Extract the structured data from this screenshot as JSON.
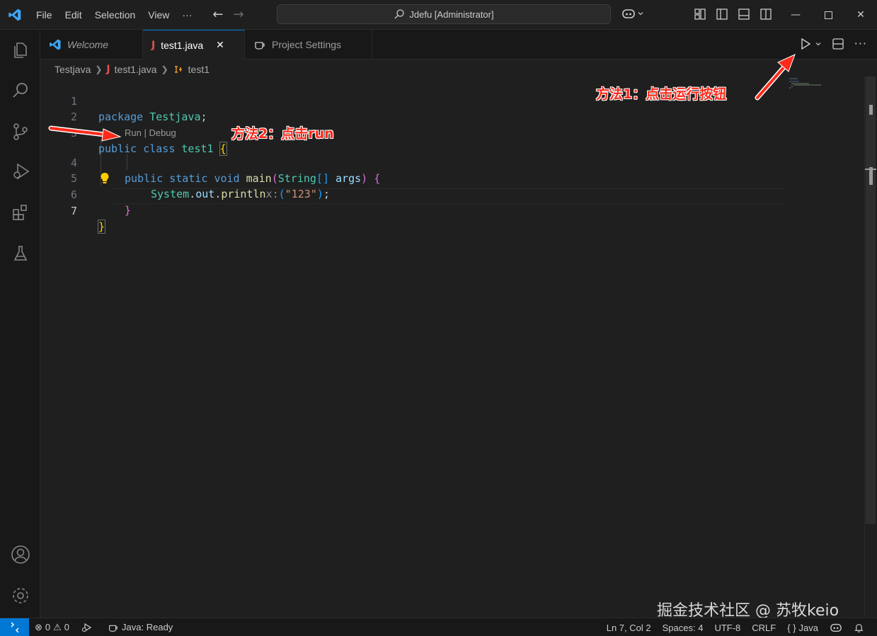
{
  "titlebar": {
    "menu": [
      "File",
      "Edit",
      "Selection",
      "View",
      "···"
    ],
    "search_text": "Jdefu [Administrator]"
  },
  "tabs": [
    {
      "label": "Welcome",
      "icon": "vscode-icon"
    },
    {
      "label": "test1.java",
      "icon": "java-icon",
      "active": true
    },
    {
      "label": "Project Settings",
      "icon": "coffee-icon"
    }
  ],
  "breadcrumb": {
    "folder": "Testjava",
    "file": "test1.java",
    "symbol": "test1"
  },
  "code": {
    "l1": {
      "num": "1",
      "kw": "package",
      "name": "Testjava",
      "semi": ";"
    },
    "l2": {
      "num": "2"
    },
    "l3": {
      "num": "3",
      "kw1": "public",
      "kw2": "class",
      "name": "test1",
      "brace": "{"
    },
    "codelens": "Run | Debug",
    "l4": {
      "num": "4",
      "kw1": "public",
      "kw2": "static",
      "kw3": "void",
      "fn": "main",
      "p1": "(",
      "type": "String",
      "arr": "[]",
      "arg": "args",
      "p2": ")",
      "brace": "{"
    },
    "l5": {
      "num": "5",
      "cls": "System",
      "dot1": ".",
      "field": "out",
      "dot2": ".",
      "fn": "println",
      "hint": "x:",
      "p1": "(",
      "str": "\"123\"",
      "p2": ")",
      "semi": ";"
    },
    "l6": {
      "num": "6",
      "brace": "}"
    },
    "l7": {
      "num": "7",
      "brace": "}"
    }
  },
  "annotations": {
    "method1": "方法1：点击运行按钮",
    "method2": "方法2：点击run"
  },
  "watermark": "掘金技术社区 @ 苏牧keio",
  "status": {
    "errors": "0",
    "warnings": "0",
    "java": "Java: Ready",
    "position": "Ln 7, Col 2",
    "spaces": "Spaces: 4",
    "encoding": "UTF-8",
    "eol": "CRLF",
    "language": "Java"
  },
  "colors": {
    "accent": "#0078d4",
    "annotation": "#ff2a1a"
  }
}
